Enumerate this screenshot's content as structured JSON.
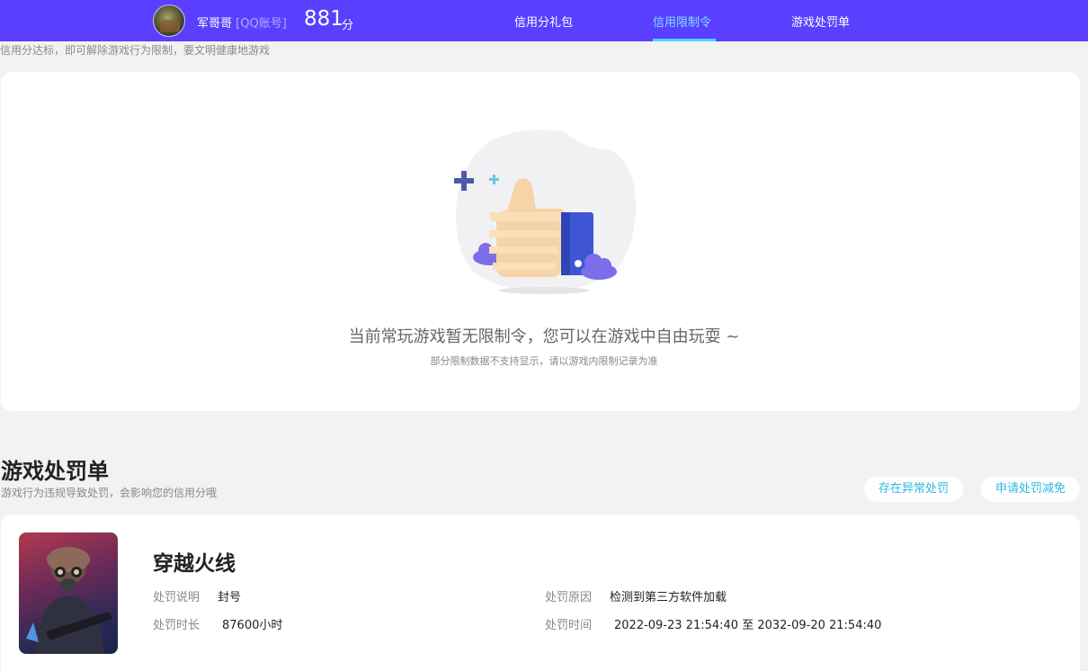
{
  "header": {
    "username": "军哥哥",
    "account_type": "[QQ账号]",
    "score": "881",
    "score_unit": "分",
    "nav": [
      {
        "label": "信用分礼包",
        "active": false
      },
      {
        "label": "信用限制令",
        "active": true
      },
      {
        "label": "游戏处罚单",
        "active": false
      }
    ]
  },
  "restriction": {
    "tagline": "信用分达标，即可解除游戏行为限制，要文明健康地游戏",
    "empty_title": "当前常玩游戏暂无限制令，您可以在游戏中自由玩耍 ~",
    "empty_sub": "部分限制数据不支持显示，请以游戏内限制记录为准"
  },
  "penalty": {
    "title": "游戏处罚单",
    "subtitle": "游戏行为违规导致处罚，会影响您的信用分哦",
    "buttons": {
      "abnormal": "存在异常处罚",
      "reduce": "申请处罚减免"
    },
    "item": {
      "game_name": "穿越火线",
      "desc_label": "处罚说明",
      "desc_value": "封号",
      "reason_label": "处罚原因",
      "reason_value": "检测到第三方软件加载",
      "duration_label": "处罚时长",
      "duration_value": "87600小时",
      "time_label": "处罚时间",
      "time_value": "2022-09-23 21:54:40 至 2032-09-20 21:54:40"
    }
  },
  "colors": {
    "topbar": "#5a3fff",
    "nav_active": "#7ee0ff",
    "pill_text": "#2fb8e0"
  },
  "icons": [
    "avatar",
    "thumbs-up-illustration",
    "game-cover-image"
  ]
}
